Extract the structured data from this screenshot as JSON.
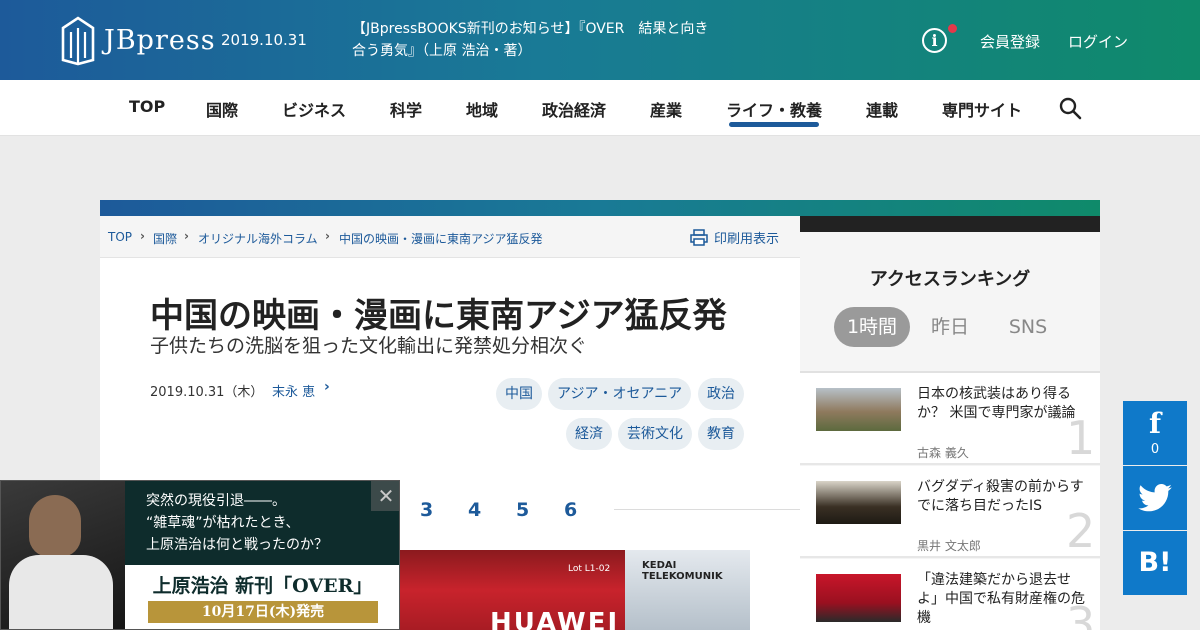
{
  "header": {
    "logo_text": "JBpress",
    "date": "2019.10.31",
    "notice": "【JBpressBOOKS新刊のお知らせ】『OVER　結果と向き合う勇気』（上原 浩治・著）",
    "info_icon": "i",
    "register": "会員登録",
    "login": "ログイン",
    "accent_color": "#1d5a9a"
  },
  "nav": {
    "items": [
      "TOP",
      "国際",
      "ビジネス",
      "科学",
      "地域",
      "政治経済",
      "産業",
      "ライフ・教養",
      "連載",
      "専門サイト"
    ],
    "active": "ライフ・教養"
  },
  "breadcrumb": [
    "TOP",
    "国際",
    "オリジナル海外コラム",
    "中国の映画・漫画に東南アジア猛反発"
  ],
  "print_label": "印刷用表示",
  "article": {
    "title": "中国の映画・漫画に東南アジア猛反発",
    "subtitle": "子供たちの洗脳を狙った文化輸出に発禁処分相次ぐ",
    "date": "2019.10.31（木）",
    "author": "末永 恵",
    "tags": [
      "中国",
      "アジア・オセアニア",
      "政治",
      "経済",
      "芸術文化",
      "教育"
    ],
    "pages": [
      "3",
      "4",
      "5",
      "6"
    ],
    "photo_labels": [
      "Lot L1-02",
      "KEDAI TELEKOMUNIK",
      "HUAWEI"
    ]
  },
  "ranking": {
    "title": "アクセスランキング",
    "tabs": [
      "1時間",
      "昨日",
      "SNS"
    ],
    "active_tab": "1時間",
    "items": [
      {
        "rank": "1",
        "title": "日本の核武装はあり得るか？ 米国で専門家が議論",
        "author": "古森 義久"
      },
      {
        "rank": "2",
        "title": "バグダディ殺害の前からすでに落ち目だったIS",
        "author": "黒井 文太郎"
      },
      {
        "rank": "3",
        "title": "「違法建築だから退去せよ」中国で私有財産権の危機",
        "author": ""
      }
    ]
  },
  "share": {
    "facebook_icon": "f",
    "facebook_count": "0",
    "hatena_label": "B!",
    "facebook_color": "#0f79c9"
  },
  "ad": {
    "lines": [
      "突然の現役引退――。",
      "“雑草魂”が枯れたとき、",
      "上原浩治は何と戦ったのか？"
    ],
    "book_title": "上原浩治 新刊「OVER」",
    "release": "10月17日(木)発売",
    "close_icon": "✕"
  }
}
